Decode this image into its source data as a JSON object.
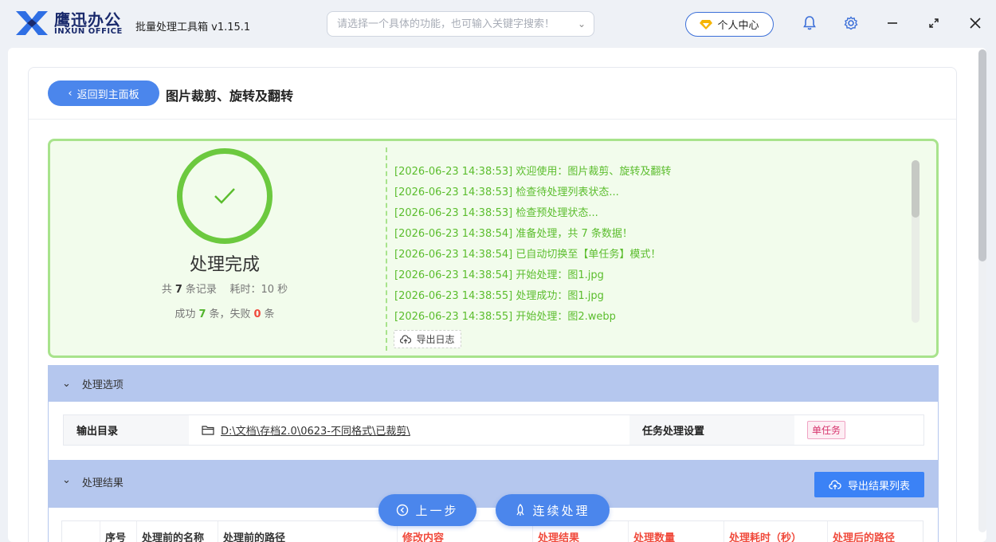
{
  "app": {
    "logo_cn": "鹰迅办公",
    "logo_en": "INXUN OFFICE",
    "title": "批量处理工具箱 v1.15.1"
  },
  "search": {
    "placeholder": "请选择一个具体的功能，也可输入关键字搜索！"
  },
  "user_center": {
    "label": "个人中心"
  },
  "nav": {
    "back_label": "返回到主面板",
    "page_title": "图片裁剪、旋转及翻转"
  },
  "status": {
    "title": "处理完成",
    "total_prefix": "共",
    "total": "7",
    "total_suffix": "条记录",
    "time_prefix": "耗时：",
    "time": "10",
    "time_unit": "秒",
    "success_prefix": "成功",
    "success": "7",
    "success_suffix": "条，失败",
    "fail": "0",
    "fail_suffix": "条"
  },
  "log": {
    "lines": [
      "[2026-06-23 14:38:53] 欢迎使用：图片裁剪、旋转及翻转",
      "[2026-06-23 14:38:53] 检查待处理列表状态...",
      "[2026-06-23 14:38:53] 检查预处理状态...",
      "[2026-06-23 14:38:54] 准备处理，共 7 条数据！",
      "[2026-06-23 14:38:54] 已自动切换至【单任务】模式！",
      "[2026-06-23 14:38:54] 开始处理：图1.jpg",
      "[2026-06-23 14:38:55] 处理成功：图1.jpg",
      "[2026-06-23 14:38:55] 开始处理：图2.webp"
    ],
    "export_label": "导出日志"
  },
  "options": {
    "header": "处理选项",
    "output_dir_label": "输出目录",
    "output_dir_value": "D:\\文档\\存档2.0\\0623-不同格式\\已裁剪\\",
    "task_setting_label": "任务处理设置",
    "task_mode": "单任务"
  },
  "results": {
    "header": "处理结果",
    "export_label": "导出结果列表",
    "columns": [
      "",
      "序号",
      "处理前的名称",
      "处理前的路径",
      "修改内容",
      "处理结果",
      "处理数量",
      "处理耗时（秒）",
      "处理后的路径"
    ]
  },
  "actions": {
    "prev_label": "上一步",
    "continue_label": "连续处理"
  },
  "colors": {
    "accent": "#4b86ec",
    "success": "#5bbd2d",
    "fail": "#f04a3c",
    "section": "#b5c7ee"
  }
}
